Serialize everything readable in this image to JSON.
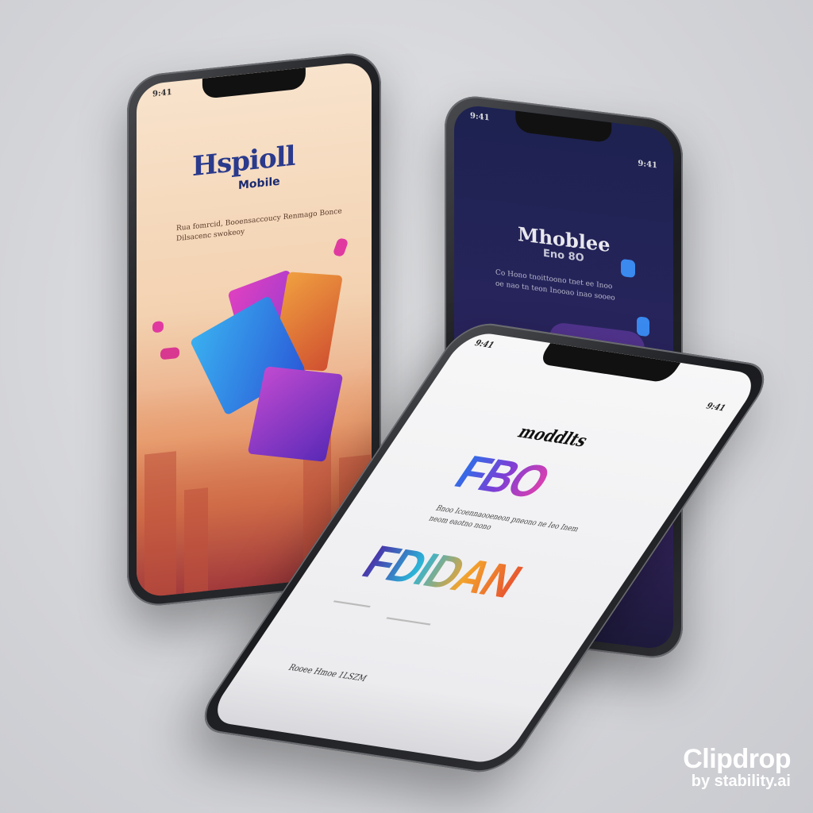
{
  "phones": {
    "left": {
      "status_time": "9:41",
      "title": "Hspioll",
      "subtitle": "Mobile",
      "body": "Rua fomrcid, Booensaccoucy Renmago Bonce Dilsacenc swokeoy",
      "colors": {
        "top": "#f8e3cc",
        "bottom": "#b0493d",
        "accent": "#2f6ee8"
      }
    },
    "right": {
      "status_time": "9:41",
      "status_right": "9:41",
      "title": "Mhoblee",
      "subtitle": "Eno 8O",
      "body": "Co Hono tnoittoono tnet ee Inoo oe nao tn teon Inooao inao sooeo",
      "colors": {
        "top": "#1d2250",
        "bottom": "#3a2766"
      }
    },
    "front": {
      "status_time": "9:41",
      "status_right": "9:41",
      "title": "moddlts",
      "big_word_1": "FBO",
      "body": "Bnoo Icoennaooeneon pneono ne Ieo Inem neom eaotno nono",
      "big_word_2": "FDIDAN",
      "footer": "Rooee Hmoe 1LSZM",
      "colors": {
        "screen": "#f7f7f8"
      }
    }
  },
  "watermark": {
    "line1": "Clipdrop",
    "line2": "by stability.ai"
  }
}
